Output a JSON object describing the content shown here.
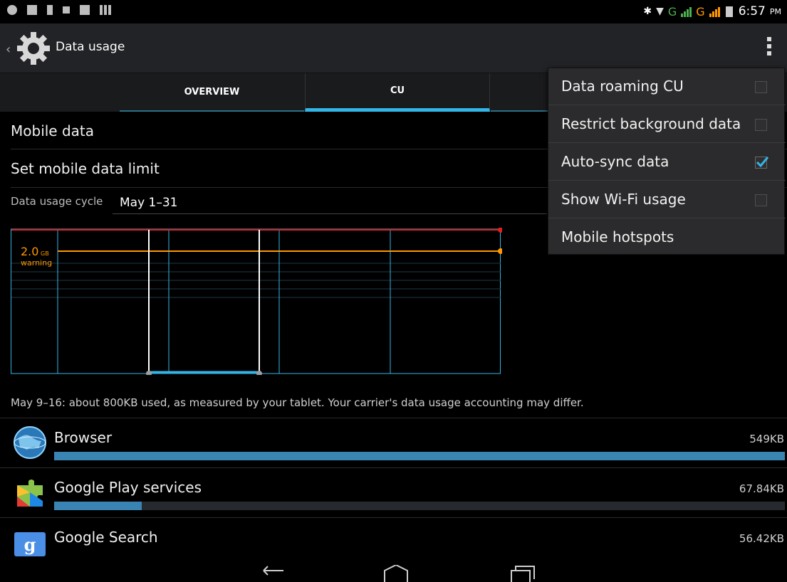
{
  "status_bar": {
    "time": "6:57",
    "ampm": "PM",
    "network_letter_1": "G",
    "network_letter_2": "G",
    "icons": [
      "chrome-icon",
      "gallery-icon",
      "usb-icon",
      "lock-icon",
      "gallery-icon",
      "barcode-icon",
      "bluetooth-icon",
      "wifi-icon",
      "signal-icon",
      "signal-icon",
      "battery-icon"
    ]
  },
  "action_bar": {
    "title": "Data usage",
    "icon": "settings-gear-icon",
    "overflow_icon": "overflow-menu-icon"
  },
  "tabs": [
    {
      "label": "OVERVIEW",
      "selected": false
    },
    {
      "label": "CU",
      "selected": true
    },
    {
      "label": "",
      "selected": false
    }
  ],
  "settings": {
    "mobile_data": "Mobile data",
    "set_limit": "Set mobile data limit",
    "cycle_label": "Data usage cycle",
    "cycle_value": "May 1–31"
  },
  "chart_data": {
    "type": "line",
    "warning_value": "2.0",
    "warning_unit": "GB",
    "warning_label": "warning",
    "colors": {
      "limit": "#e02020",
      "warning": "#ff9800",
      "grid": "#33b5e5",
      "sweep": "#ffffff"
    }
  },
  "usage_note": "May 9–16: about 800KB used, as measured by your tablet. Your carrier's data usage accounting may differ.",
  "apps": [
    {
      "name": "Browser",
      "size": "549KB",
      "fraction": 1.0,
      "icon": "browser-globe-icon"
    },
    {
      "name": "Google Play services",
      "size": "67.84KB",
      "fraction": 0.12,
      "icon": "google-play-services-icon"
    },
    {
      "name": "Google Search",
      "size": "56.42KB",
      "fraction": 0.1,
      "icon": "google-search-icon"
    }
  ],
  "menu": [
    {
      "label": "Data roaming CU",
      "checkbox": true,
      "checked": false
    },
    {
      "label": "Restrict background data",
      "checkbox": true,
      "checked": false
    },
    {
      "label": "Auto-sync data",
      "checkbox": true,
      "checked": true
    },
    {
      "label": "Show Wi-Fi usage",
      "checkbox": true,
      "checked": false
    },
    {
      "label": "Mobile hotspots",
      "checkbox": false,
      "checked": false
    }
  ],
  "nav": [
    "back-icon",
    "home-icon",
    "recents-icon"
  ],
  "accent_color": "#33b5e5"
}
